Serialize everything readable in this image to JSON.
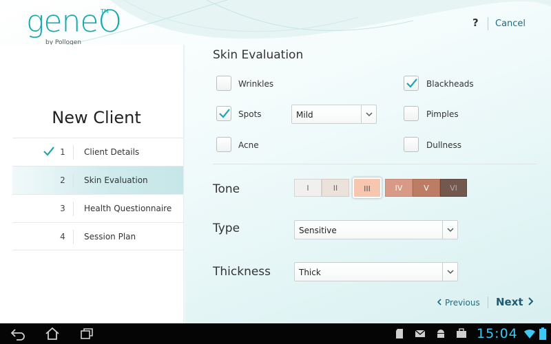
{
  "brand": {
    "name": "geneO",
    "tm": "TM",
    "by": "by Pollogen"
  },
  "header": {
    "help": "?",
    "cancel": "Cancel"
  },
  "sidebar": {
    "title": "New Client",
    "steps": [
      {
        "num": "1",
        "label": "Client Details",
        "done": true
      },
      {
        "num": "2",
        "label": "Skin Evaluation",
        "active": true
      },
      {
        "num": "3",
        "label": "Health Questionnaire"
      },
      {
        "num": "4",
        "label": "Session Plan"
      }
    ]
  },
  "evaluation": {
    "title": "Skin Evaluation",
    "conditions": {
      "wrinkles": {
        "label": "Wrinkles",
        "checked": false
      },
      "spots": {
        "label": "Spots",
        "checked": true
      },
      "acne": {
        "label": "Acne",
        "checked": false
      },
      "blackheads": {
        "label": "Blackheads",
        "checked": true
      },
      "pimples": {
        "label": "Pimples",
        "checked": false
      },
      "dullness": {
        "label": "Dullness",
        "checked": false
      }
    },
    "spots_severity": "Mild",
    "tone": {
      "label": "Tone",
      "options": [
        "I",
        "II",
        "III",
        "IV",
        "V",
        "VI"
      ],
      "selected": "III",
      "colors": [
        "#f2f0ee",
        "#ece2dc",
        "#f6c6ae",
        "#d89a86",
        "#bd7d64",
        "#73584d"
      ]
    },
    "type": {
      "label": "Type",
      "value": "Sensitive"
    },
    "thickness": {
      "label": "Thickness",
      "value": "Thick"
    }
  },
  "nav": {
    "previous": "Previous",
    "next": "Next"
  },
  "statusbar": {
    "time": "15:04"
  },
  "colors": {
    "accent": "#1aa8ae",
    "link": "#1d6b80",
    "clock": "#3cc7f5"
  }
}
